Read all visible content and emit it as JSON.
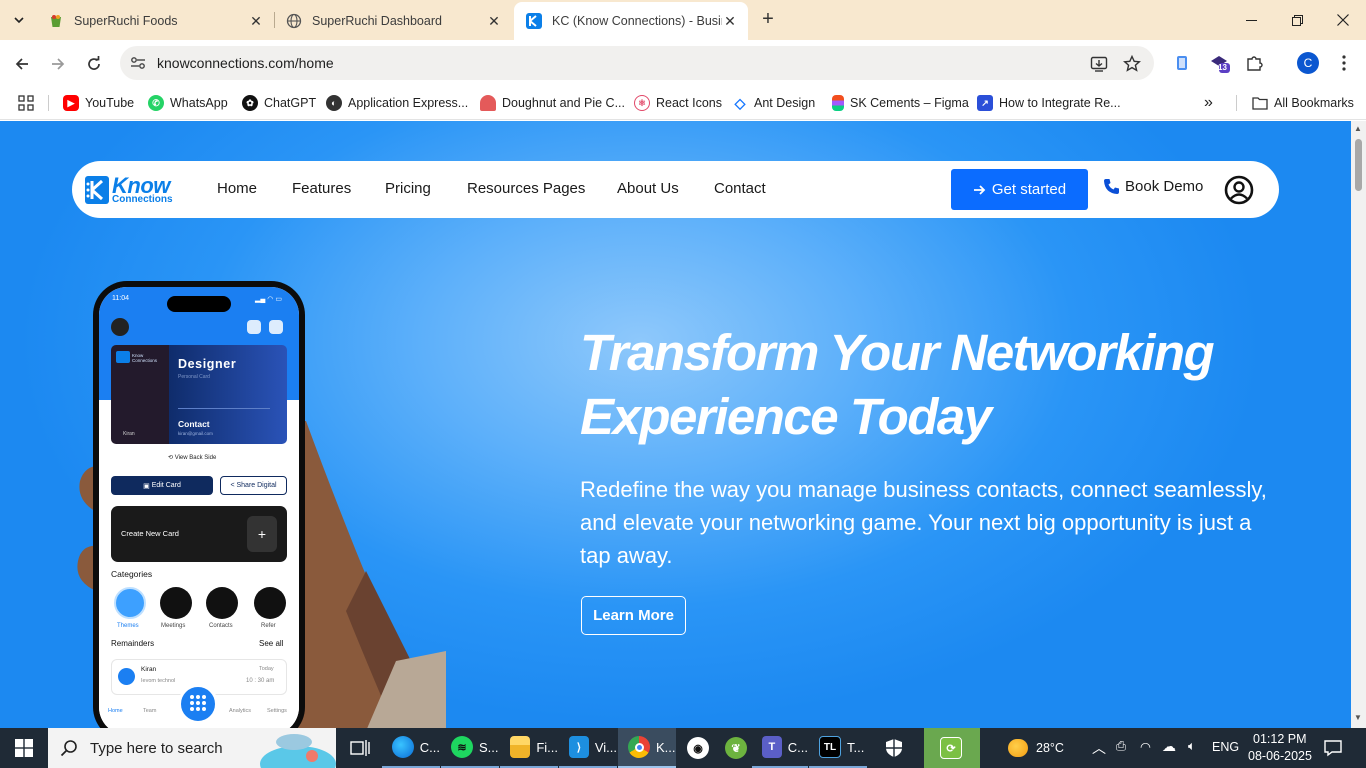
{
  "browser": {
    "tabs": [
      {
        "title": "SuperRuchi Foods",
        "active": false
      },
      {
        "title": "SuperRuchi Dashboard",
        "active": false
      },
      {
        "title": "KC (Know Connections) - Busine",
        "active": true
      }
    ],
    "url": "knowconnections.com/home",
    "extension_badge": "13",
    "profile_initial": "C",
    "bookmarks": [
      {
        "label": "YouTube",
        "icon": "youtube-icon"
      },
      {
        "label": "WhatsApp",
        "icon": "whatsapp-icon"
      },
      {
        "label": "ChatGPT",
        "icon": "chatgpt-icon"
      },
      {
        "label": "Application Express...",
        "icon": "apex-icon"
      },
      {
        "label": "Doughnut and Pie C...",
        "icon": "chart-icon"
      },
      {
        "label": "React Icons",
        "icon": "react-icon"
      },
      {
        "label": "Ant Design",
        "icon": "antd-icon"
      },
      {
        "label": "SK Cements – Figma",
        "icon": "figma-icon"
      },
      {
        "label": "How to Integrate Re...",
        "icon": "link-icon"
      }
    ],
    "all_bookmarks": "All Bookmarks"
  },
  "site": {
    "logo": {
      "line1": "Know",
      "line2": "Connections"
    },
    "nav": [
      "Home",
      "Features",
      "Pricing",
      "Resources Pages",
      "About Us",
      "Contact"
    ],
    "get_started": "Get started",
    "book_demo": "Book Demo",
    "hero": {
      "title_line1": "Transform Your Networking",
      "title_line2": "Experience Today",
      "subtitle": "Redefine the way you manage business contacts, connect seamlessly, and elevate your networking game. Your next big opportunity is just a tap away.",
      "cta": "Learn More"
    },
    "phone": {
      "time": "11:04",
      "card_title": "Designer",
      "card_sub": "Personal Card",
      "card_contact": "Contact",
      "card_email": "kiran@gmail.com",
      "card_name": "Kiran",
      "card_logo": "Know Connections",
      "view_back": "View Back Side",
      "edit_card": "Edit Card",
      "share_digital": "Share Digital",
      "create_new": "Create New Card",
      "categories_title": "Categories",
      "categories": [
        "Themes",
        "Meetings",
        "Contacts",
        "Refer"
      ],
      "remainders_title": "Remainders",
      "see_all": "See all",
      "reminder_name": "Kiran",
      "reminder_company": "Ievom technol",
      "reminder_day": "Today",
      "reminder_time": "10 : 30 am",
      "bottom_nav": [
        "Home",
        "Team",
        "Analytics",
        "Settings"
      ]
    }
  },
  "taskbar": {
    "search_placeholder": "Type here to search",
    "apps": [
      {
        "label": "C...",
        "icon": "edge-icon"
      },
      {
        "label": "S...",
        "icon": "spotify-icon"
      },
      {
        "label": "Fi...",
        "icon": "file-explorer-icon"
      },
      {
        "label": "Vi...",
        "icon": "vscode-icon"
      },
      {
        "label": "K...",
        "icon": "chrome-icon"
      },
      {
        "label": "C...",
        "icon": "teams-icon"
      },
      {
        "label": "T...",
        "icon": "tl-icon"
      }
    ],
    "weather": "28°C",
    "language": "ENG",
    "time": "01:12 PM",
    "date": "08-06-2025"
  },
  "colors": {
    "brand_blue": "#0b6cff",
    "hero_bg": "#1c89f1",
    "tab_strip": "#f8e8cf"
  }
}
